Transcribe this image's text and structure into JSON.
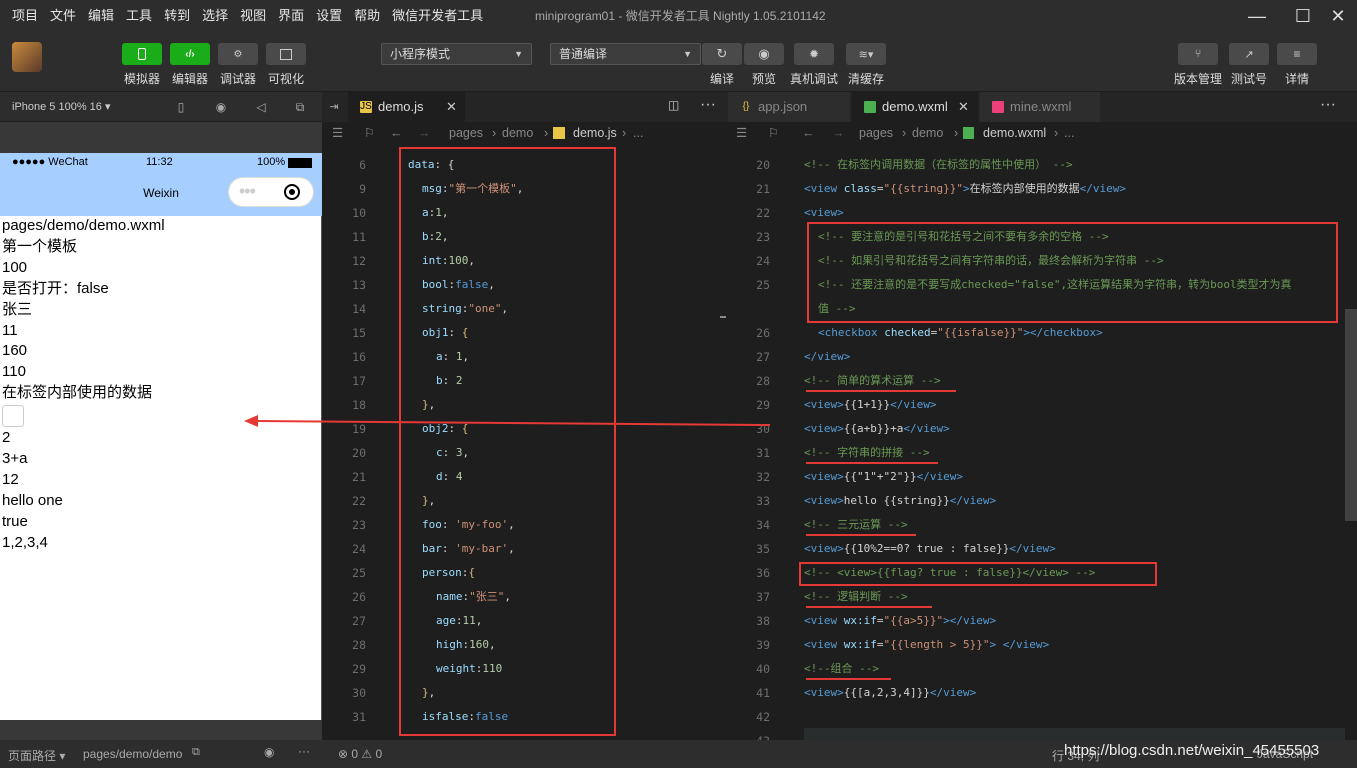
{
  "menu": [
    "项目",
    "文件",
    "编辑",
    "工具",
    "转到",
    "选择",
    "视图",
    "界面",
    "设置",
    "帮助",
    "微信开发者工具"
  ],
  "window_title": "miniprogram01 - 微信开发者工具 Nightly 1.05.2101142",
  "toolbar": {
    "simulator": "模拟器",
    "editor": "编辑器",
    "debugger": "调试器",
    "visual": "可视化",
    "mode_select": "小程序模式",
    "compile_select": "普通编译",
    "compile": "编译",
    "preview": "预览",
    "remote_debug": "真机调试",
    "clear_cache": "清缓存",
    "version": "版本管理",
    "test_account": "测试号",
    "details": "详情"
  },
  "simulator": {
    "device": "iPhone 5 100% 16 ▾",
    "status_left": "●●●●● WeChat",
    "status_time": "11:32",
    "status_right": "100%",
    "nav_title": "Weixin",
    "lines_before": [
      "pages/demo/demo.wxml",
      "第一个模板",
      "100",
      "是否打开：false",
      "张三",
      "11",
      "160",
      "110",
      "在标签内部使用的数据"
    ],
    "lines_after": [
      "2",
      "3+a",
      "12",
      "hello one",
      "true",
      "1,2,3,4"
    ],
    "footer_path_label": "页面路径 ▾",
    "footer_path": "pages/demo/demo"
  },
  "left_editor": {
    "tab": "demo.js",
    "breadcrumb": [
      "pages",
      "demo",
      "demo.js",
      "..."
    ],
    "line_numbers": [
      "6",
      "9",
      "10",
      "11",
      "12",
      "13",
      "14",
      "15",
      "16",
      "17",
      "18",
      "19",
      "20",
      "21",
      "22",
      "23",
      "24",
      "25",
      "26",
      "27",
      "28",
      "29",
      "30",
      "31"
    ]
  },
  "right_editor": {
    "tabs": [
      "app.json",
      "demo.wxml",
      "mine.wxml"
    ],
    "breadcrumb": [
      "pages",
      "demo",
      "demo.wxml",
      "..."
    ],
    "line_numbers": [
      "20",
      "21",
      "22",
      "23",
      "24",
      "25",
      "",
      "26",
      "27",
      "28",
      "29",
      "30",
      "31",
      "32",
      "33",
      "34",
      "35",
      "36",
      "37",
      "38",
      "39",
      "40",
      "41",
      "42",
      "43"
    ]
  },
  "status": {
    "problems": "⊗ 0 ⚠ 0",
    "position": "行 34, 列",
    "lang": "JavaScript",
    "watermark": "https://blog.csdn.net/weixin_45455503"
  },
  "colors": {
    "green": "#1aad19",
    "nav_blue": "#a6ceff",
    "annotation_red": "#e53935"
  }
}
